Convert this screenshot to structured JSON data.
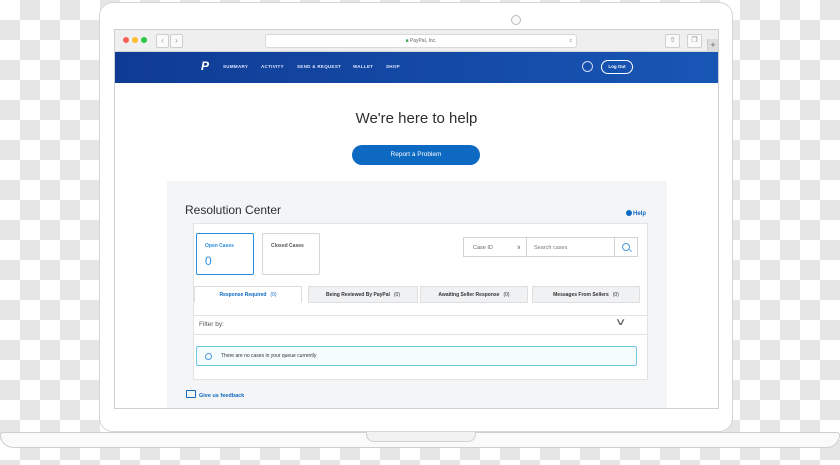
{
  "browser": {
    "url": "PayPal, Inc.",
    "back_label": "‹",
    "forward_label": "›",
    "reload_label": "c",
    "share_label": "⇧",
    "tabs_label": "❐",
    "new_tab_label": "+",
    "traffic_colors": [
      "#ff5f57",
      "#febc2e",
      "#28c840"
    ]
  },
  "nav": {
    "logo": "P",
    "items": [
      {
        "label": "SUMMARY"
      },
      {
        "label": "ACTIVITY"
      },
      {
        "label": "SEND & REQUEST"
      },
      {
        "label": "WALLET"
      },
      {
        "label": "SHOP"
      }
    ],
    "logout_label": "Log Out"
  },
  "hero": {
    "title": "We're here to help",
    "report_button": "Report a Problem"
  },
  "resolution": {
    "title": "Resolution Center",
    "help_label": "Help",
    "open_cases": {
      "label": "Open Cases",
      "count": "0"
    },
    "closed_cases": {
      "label": "Closed Cases"
    },
    "case_id_select": "Case ID",
    "search_placeholder": "Search cases",
    "tabs": [
      {
        "label": "Response Required",
        "count": "(0)"
      },
      {
        "label": "Being Reviewed By PayPal",
        "count": "(0)"
      },
      {
        "label": "Awaiting Seller Response",
        "count": "(0)"
      },
      {
        "label": "Messages From Sellers",
        "count": "(0)"
      }
    ],
    "filter_label": "Filter by:",
    "empty_notice": "There are no cases in your queue currently",
    "feedback_label": "Give us feedback"
  },
  "colors": {
    "nav_start": "#0f3b94",
    "nav_end": "#1856b5",
    "accent": "#0d69c1"
  }
}
